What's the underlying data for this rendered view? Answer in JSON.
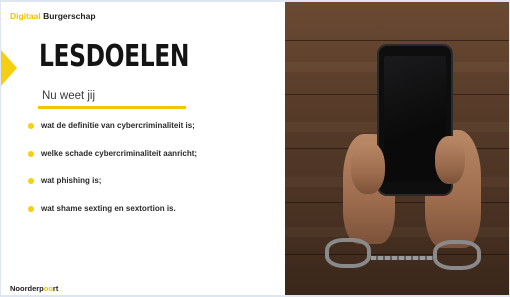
{
  "header": {
    "brand_accent": "Digitaal",
    "brand_rest": "Burgerschap"
  },
  "slide": {
    "title": "LESDOELEN",
    "subtitle": "Nu weet jij",
    "goals": [
      "wat de definitie van cybercriminaliteit is;",
      "welke schade cybercriminaliteit aanricht;",
      "wat phishing is;",
      "wat shame sexting en sextortion is."
    ]
  },
  "footer": {
    "logo_part1": "Noorderp",
    "logo_part2": "oo",
    "logo_part3": "rt"
  },
  "colors": {
    "accent": "#f5cf11",
    "text": "#141414",
    "wood": "#553a28"
  }
}
